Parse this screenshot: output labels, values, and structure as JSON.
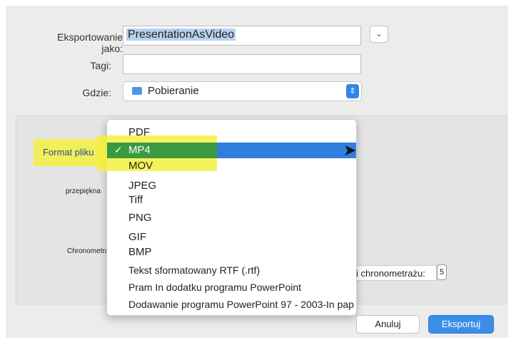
{
  "form": {
    "export_as_label": "Eksportowanie jako:",
    "filename_value": "PresentationAsVideo",
    "tags_label": "Tagi:",
    "tags_value": "",
    "where_label": "Gdzie:",
    "where_value": "Pobieranie"
  },
  "options": {
    "file_format_label": "Format pliku",
    "quality_label": "przepiękna",
    "timings_label": "Chronometraż",
    "timings_hint": "s",
    "timings_field_value": "i chronometrażu:",
    "timings_spinner": "5"
  },
  "format_menu": {
    "items": [
      {
        "label": "PDF",
        "selected": false
      },
      {
        "label": "MP4",
        "selected": true
      },
      {
        "label": "MOV",
        "selected": false
      },
      {
        "label": "JPEG",
        "selected": false
      },
      {
        "label": "Tiff",
        "selected": false
      },
      {
        "label": "PNG",
        "selected": false
      },
      {
        "label": "GIF",
        "selected": false
      },
      {
        "label": "BMP",
        "selected": false
      },
      {
        "label": "Tekst sformatowany RTF (.rtf)",
        "selected": false
      },
      {
        "label": "Pram In dodatku programu PowerPoint",
        "selected": false
      },
      {
        "label": "Dodawanie programu PowerPoint 97 - 2003-In pap",
        "selected": false
      }
    ],
    "check_glyph": "✓"
  },
  "buttons": {
    "cancel": "Anuluj",
    "export": "Eksportuj"
  },
  "colors": {
    "accent": "#2f7de1",
    "highlight": "#f3f13f"
  }
}
